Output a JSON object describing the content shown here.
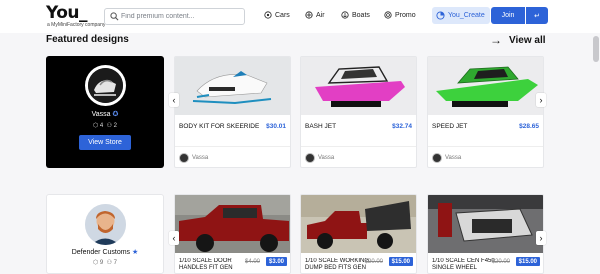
{
  "brand": {
    "logo_text": "You_",
    "tagline": "a MyMiniFactory company"
  },
  "search": {
    "placeholder": "Find premium content..."
  },
  "nav": {
    "items": [
      {
        "label": "Cars",
        "icon": "wheel-icon"
      },
      {
        "label": "Air",
        "icon": "propeller-icon"
      },
      {
        "label": "Boats",
        "icon": "anchor-icon"
      },
      {
        "label": "Promo",
        "icon": "gear-icon"
      }
    ]
  },
  "account": {
    "create_label": "You_Create",
    "join_label": "Join",
    "dropdown_glyph": "↵"
  },
  "section": {
    "title": "Featured designs",
    "view_all": "View all",
    "arrow": "→"
  },
  "designers": [
    {
      "name": "Vassa",
      "followers": "4",
      "members": "2",
      "button": "View Store"
    },
    {
      "name": "Defender Customs",
      "followers": "9",
      "members": "7"
    }
  ],
  "products_row1": [
    {
      "name": "BODY KIT FOR SKEERIDE 2",
      "price": "$30.01",
      "seller": "Vassa"
    },
    {
      "name": "BASH JET",
      "price": "$32.74",
      "seller": "Vassa"
    },
    {
      "name": "SPEED JET",
      "price": "$28.65",
      "seller": "Vassa"
    }
  ],
  "products_row2": [
    {
      "name": "1/10 SCALE DOOR HANDLES FIT GEN",
      "old_price": "$4.00",
      "price": "$3.00"
    },
    {
      "name": "1/10 SCALE WORKING DUMP BED FITS GEN",
      "old_price": "$20.00",
      "price": "$15.00"
    },
    {
      "name": "1/10 SCALE CEN F450 SINGLE WHEEL",
      "old_price": "$20.00",
      "price": "$15.00"
    }
  ],
  "carousel": {
    "prev": "‹",
    "next": "›"
  },
  "colors": {
    "accent": "#2d63d8",
    "pink": "#e23fc4",
    "green": "#3dd13d"
  }
}
